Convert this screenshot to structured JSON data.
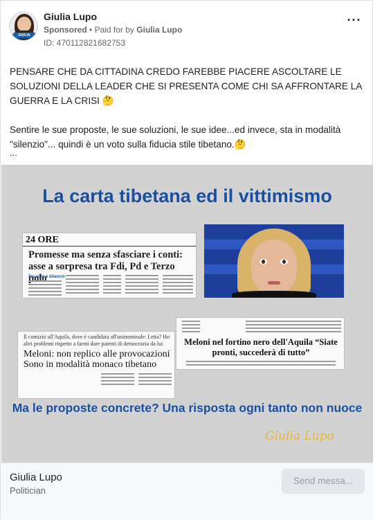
{
  "header": {
    "page_name": "Giulia Lupo",
    "sponsored": "Sponsored",
    "separator": "•",
    "paid_for_prefix": "Paid for by",
    "paid_for_name": "Giulia Lupo",
    "ad_id": "ID: 470112821682753",
    "avatar_badge": "GIULIA",
    "more_icon": "more-horizontal-icon"
  },
  "post": {
    "paragraph1": "PENSARE CHE DA CITTADINA CREDO FAREBBE PIACERE ASCOLTARE LE SOLUZIONI DELLA LEADER CHE SI PRESENTA COME CHI SA AFFRONTARE LA GUERRA E LA CRISI 🤔",
    "paragraph2": "Sentire le sue proposte, le sue soluzioni, le sue idee...ed invece, sta in modalità \"silenzio\"... quindi è un voto sulla fiducia stile tibetano.🤔",
    "ellipsis": "..."
  },
  "creative": {
    "headline": "La carta tibetana ed il vittimismo",
    "clip1_masthead": "24 ORE",
    "clip1_title": "Promesse ma senza sfasciare i conti: asse a sorpresa tra Fdi, Pd e Terzo polo",
    "clip1_tag": "Tra voto e bilancio",
    "clip2_kicker": "Il comizio all'Aquila, dove è candidata all'uninominale: Letta? Ho altri problemi rispetto a farmi dare patenti di democrazia da lui",
    "clip2_title": "Meloni: non replico alle provocazioni Sono in modalità monaco tibetano",
    "clip3_title": "Meloni nel fortino nero dell'Aquila “Siate pronti, succederà di tutto”",
    "bottom_text": "Ma le proposte concrete? Una risposta ogni tanto non nuoce",
    "signature": "Giulia Lupo",
    "colors": {
      "headline": "#1a4fa0",
      "signature": "#e8b544",
      "background": "#d2d2d2"
    }
  },
  "footer": {
    "name": "Giulia Lupo",
    "category": "Politician",
    "send_button": "Send messa..."
  }
}
